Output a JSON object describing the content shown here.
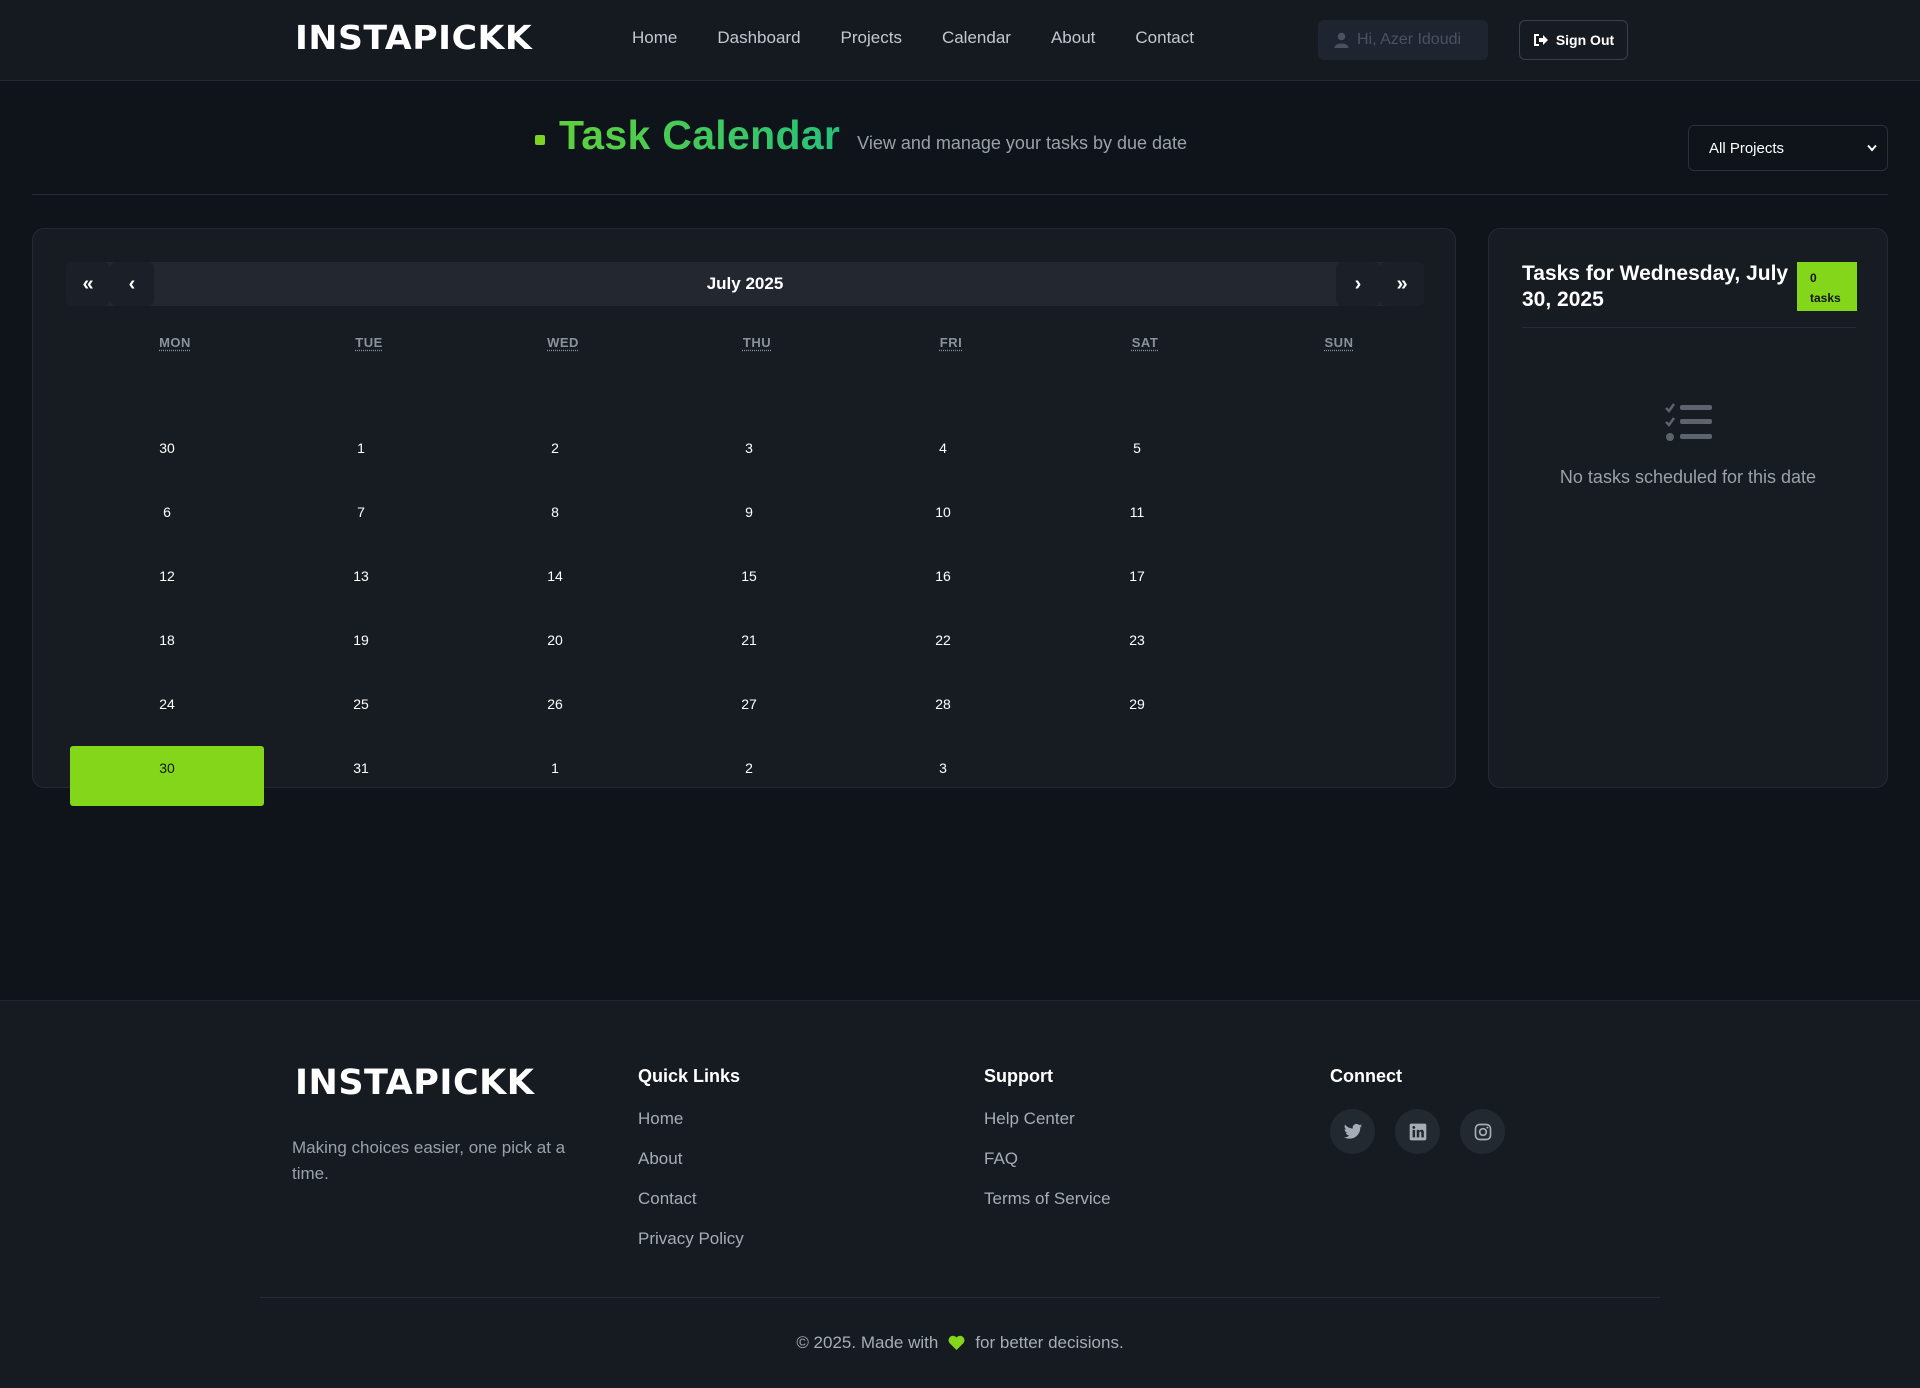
{
  "header": {
    "brand": "INSTAPICKK",
    "nav": [
      "Home",
      "Dashboard",
      "Projects",
      "Calendar",
      "About",
      "Contact"
    ],
    "user_greeting": "Hi, Azer Idoudi",
    "sign_out": "Sign Out"
  },
  "page": {
    "title": "Task Calendar",
    "subtitle": "View and manage your tasks by due date",
    "project_filter": "All Projects"
  },
  "calendar": {
    "month_label": "July 2025",
    "nav": {
      "prev_year": "«",
      "prev_month": "‹",
      "next_month": "›",
      "next_year": "»"
    },
    "weekdays": [
      "MON",
      "TUE",
      "WED",
      "THU",
      "FRI",
      "SAT",
      "SUN"
    ],
    "weeks": [
      [
        "30",
        "1",
        "2",
        "3",
        "4",
        "5",
        ""
      ],
      [
        "6",
        "7",
        "8",
        "9",
        "10",
        "11",
        ""
      ],
      [
        "12",
        "13",
        "14",
        "15",
        "16",
        "17",
        ""
      ],
      [
        "18",
        "19",
        "20",
        "21",
        "22",
        "23",
        ""
      ],
      [
        "24",
        "25",
        "26",
        "27",
        "28",
        "29",
        ""
      ],
      [
        "30",
        "31",
        "1",
        "2",
        "3",
        "",
        ""
      ]
    ],
    "selected_date": "30",
    "accent_color": "#84d61b"
  },
  "tasks": {
    "heading": "Tasks for Wednesday, July 30, 2025",
    "count": "0",
    "count_unit": "tasks",
    "empty_message": "No tasks scheduled for this date",
    "empty_icon": "tasks-list-icon"
  },
  "footer": {
    "brand": "INSTAPICKK",
    "tagline": "Making choices easier, one pick at a time.",
    "quick_links": {
      "heading": "Quick Links",
      "items": [
        "Home",
        "About",
        "Contact",
        "Privacy Policy"
      ]
    },
    "support": {
      "heading": "Support",
      "items": [
        "Help Center",
        "FAQ",
        "Terms of Service"
      ]
    },
    "connect": {
      "heading": "Connect",
      "icons": [
        "twitter-icon",
        "linkedin-icon",
        "instagram-icon"
      ]
    },
    "copyright_before": "© 2025. Made with",
    "copyright_after": "for better decisions."
  }
}
